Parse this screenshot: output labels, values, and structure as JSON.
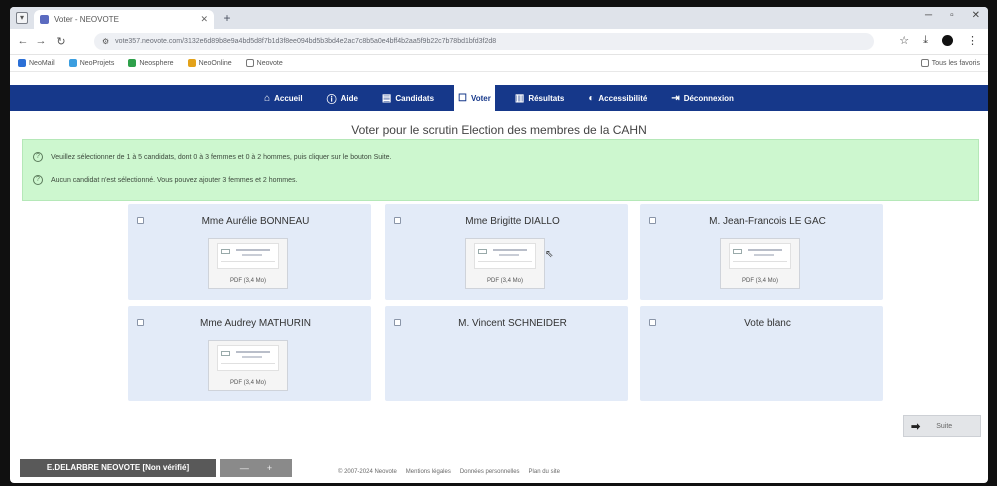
{
  "browser": {
    "tab_title": "Voter - NEOVOTE",
    "url": "vote357.neovote.com/3132e6d89b8e9a4bd5d8f7b1d3f8ee094bd5b3bd4e2ac7c8b5a0e4bff4b2aa5f9b22c7b78bd1bfd3f2d8",
    "bookmarks": [
      "NeoMail",
      "NeoProjets",
      "Neosphere",
      "NeoOnline",
      "Neovote"
    ],
    "bookmarks_right": "Tous les favoris"
  },
  "nav": {
    "items": [
      {
        "label": "Accueil",
        "icon": "home-icon"
      },
      {
        "label": "Aide",
        "icon": "help-icon"
      },
      {
        "label": "Candidats",
        "icon": "id-card-icon"
      },
      {
        "label": "Voter",
        "icon": "ballot-box-icon",
        "active": true
      },
      {
        "label": "Résultats",
        "icon": "bar-chart-icon"
      },
      {
        "label": "Accessibilité",
        "icon": "accessibility-icon"
      },
      {
        "label": "Déconnexion",
        "icon": "logout-icon"
      }
    ]
  },
  "page": {
    "title": "Voter pour le scrutin Election des membres de la CAHN"
  },
  "info": {
    "line1": "Veuillez sélectionner de 1 à 5 candidats, dont 0 à 3 femmes et 0 à 2 hommes, puis cliquer sur le bouton Suite.",
    "line2": "Aucun candidat n'est sélectionné. Vous pouvez ajouter 3 femmes et 2 hommes."
  },
  "candidates": [
    {
      "name": "Mme Aurélie BONNEAU",
      "doc": "PDF (3,4 Mo)"
    },
    {
      "name": "Mme Brigitte DIALLO",
      "doc": "PDF (3,4 Mo)"
    },
    {
      "name": "M. Jean-Francois LE GAC",
      "doc": "PDF (3,4 Mo)"
    },
    {
      "name": "Mme Audrey MATHURIN",
      "doc": "PDF (3,4 Mo)"
    },
    {
      "name": "M. Vincent SCHNEIDER"
    },
    {
      "name": "Vote blanc"
    }
  ],
  "actions": {
    "suite_label": "Suite"
  },
  "user": {
    "badge": "E.DELARBRE NEOVOTE [Non vérifié]",
    "extra_left": "—",
    "extra_right": "+"
  },
  "footer": {
    "copyright": "© 2007-2024 Neovote",
    "links": [
      "Mentions légales",
      "Données personnelles",
      "Plan du site"
    ]
  },
  "colors": {
    "nav_bg": "#16388a",
    "info_bg": "#cdf7cf",
    "card_bg": "#e3ebf8"
  }
}
